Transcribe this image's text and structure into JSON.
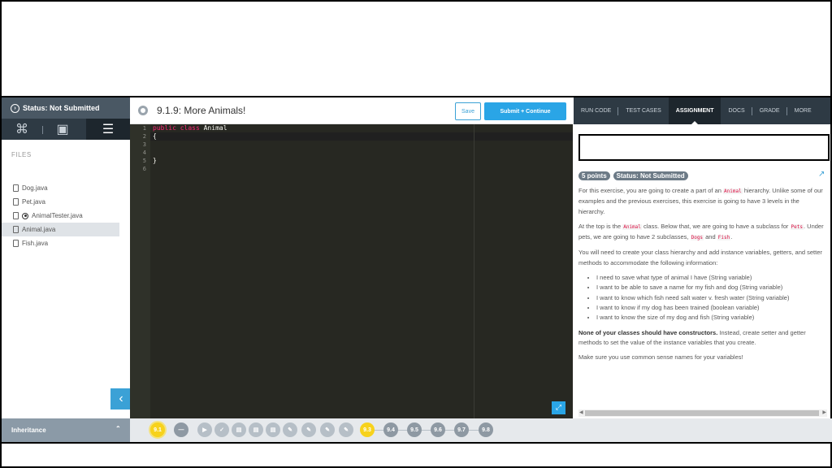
{
  "sidebar": {
    "status": "Status: Not Submitted",
    "tabs": [
      {
        "icon": "map-icon",
        "glyph": "⌘"
      },
      {
        "icon": "book-icon",
        "glyph": "▣"
      },
      {
        "icon": "list-icon",
        "glyph": "☰"
      }
    ],
    "files_label": "FILES",
    "files": [
      "Dog.java",
      "Pet.java",
      "AnimalTester.java",
      "Animal.java",
      "Fish.java"
    ],
    "active_file": "Animal.java"
  },
  "header": {
    "title": "9.1.9: More Animals!",
    "save_label": "Save",
    "submit_label": "Submit + Continue"
  },
  "editor": {
    "line_numbers": [
      "1",
      "2",
      "3",
      "4",
      "5",
      "6"
    ],
    "lines": [
      {
        "kw": "public class",
        "text": " Animal"
      },
      {
        "kw": "",
        "text": "{"
      },
      {
        "kw": "",
        "text": ""
      },
      {
        "kw": "",
        "text": ""
      },
      {
        "kw": "",
        "text": "}"
      },
      {
        "kw": "",
        "text": ""
      }
    ]
  },
  "right_tabs": [
    "RUN CODE",
    "TEST CASES",
    "ASSIGNMENT",
    "DOCS",
    "GRADE",
    "MORE"
  ],
  "active_right_tab": "ASSIGNMENT",
  "assignment": {
    "points": "5 points",
    "status": "Status: Not Submitted",
    "p1_a": "For this exercise, you are going to create a part of an",
    "p1_code": "Animal",
    "p1_b": "hierarchy. Unlike some of our examples and the previous exercises, this exercise is going to have 3 levels in the hierarchy.",
    "p2_a": "At the top is the",
    "p2_code1": "Animal",
    "p2_b": "class. Below that, we are going to have a subclass for",
    "p2_code2": "Pets",
    "p2_c": ". Under pets, we are going to have 2 subclasses,",
    "p2_code3": "Dogs",
    "p2_d": "and",
    "p2_code4": "Fish",
    "p2_e": ".",
    "p3": "You will need to create your class hierarchy and add instance variables, getters, and setter methods to accommodate the following information:",
    "bullets": [
      "I need to save what type of animal I have (String variable)",
      "I want to be able to save a name for my fish and dog (String variable)",
      "I want to know which fish need salt water v. fresh water (String variable)",
      "I want to know if my dog has been trained (boolean variable)",
      "I want to know the size of my dog and fish (String variable)"
    ],
    "p4_bold": "None of your classes should have constructors.",
    "p4_rest": " Instead, create setter and getter methods to set the value of the instance variables that you create.",
    "p5": "Make sure you use common sense names for your variables!"
  },
  "bottom_nav": {
    "lesson": "Inheritance",
    "current": "9.1",
    "steps": [
      "9.3",
      "9.4",
      "9.5",
      "9.6",
      "9.7",
      "9.8"
    ]
  }
}
